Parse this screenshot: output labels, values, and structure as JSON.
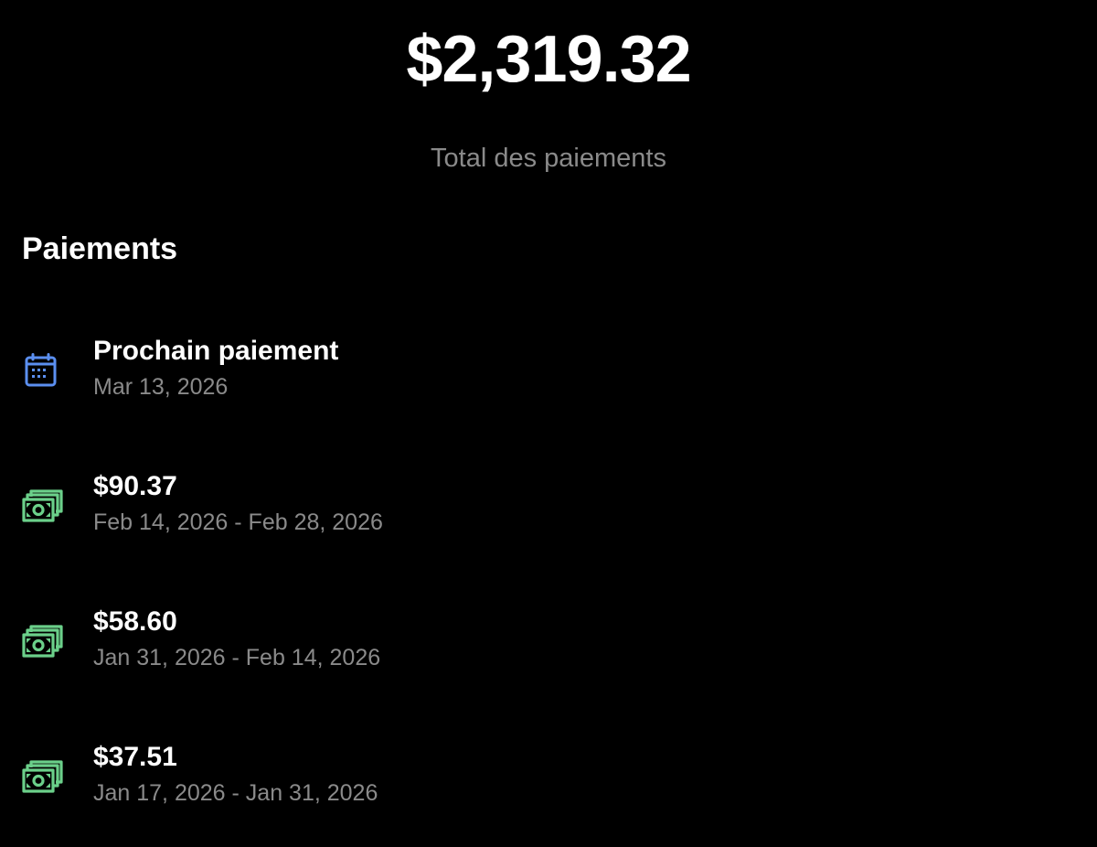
{
  "summary": {
    "total_amount": "$2,319.32",
    "total_label": "Total des paiements"
  },
  "payments": {
    "title": "Paiements",
    "next_payment": {
      "icon": "calendar-icon",
      "label": "Prochain paiement",
      "date": "Mar 13, 2026"
    },
    "items": [
      {
        "icon": "cash-icon",
        "amount": "$90.37",
        "period": "Feb 14, 2026 - Feb 28, 2026"
      },
      {
        "icon": "cash-icon",
        "amount": "$58.60",
        "period": "Jan 31, 2026 - Feb 14, 2026"
      },
      {
        "icon": "cash-icon",
        "amount": "$37.51",
        "period": "Jan 17, 2026 - Jan 31, 2026"
      }
    ]
  },
  "colors": {
    "background": "#000000",
    "primary_text": "#ffffff",
    "secondary_text": "#8a8a8a",
    "calendar_icon": "#5b8ff0",
    "cash_icon": "#6bd08a"
  }
}
